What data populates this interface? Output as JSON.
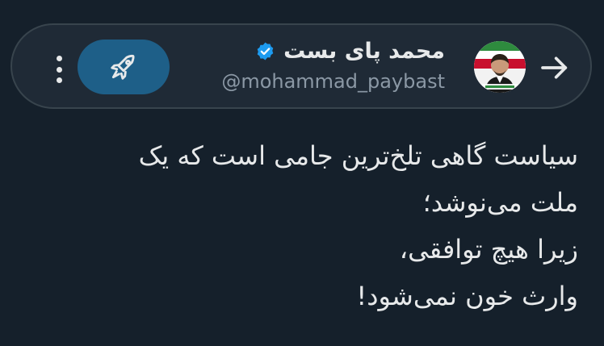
{
  "header": {
    "display_name": "محمد پای بست",
    "handle": "@mohammad_paybast",
    "verified": true,
    "icons": {
      "back": "arrow-right-icon",
      "more": "more-vertical-icon",
      "boost": "rocket-icon",
      "verified": "verified-badge-icon"
    }
  },
  "tweet": {
    "lines": [
      "سیاست گاهی تلخ‌ترین جامی است که یک",
      "ملت می‌نوشد؛",
      "زیرا هیچ توافقی،",
      "وارث خون نمی‌شود!"
    ]
  },
  "colors": {
    "background": "#15202b",
    "header_bg": "#1f2a36",
    "header_border": "#38444d",
    "boost_button": "#1e5f88",
    "verified_blue": "#1d9bf0",
    "text_primary": "#e7e9ea",
    "text_secondary": "#8b98a5"
  }
}
